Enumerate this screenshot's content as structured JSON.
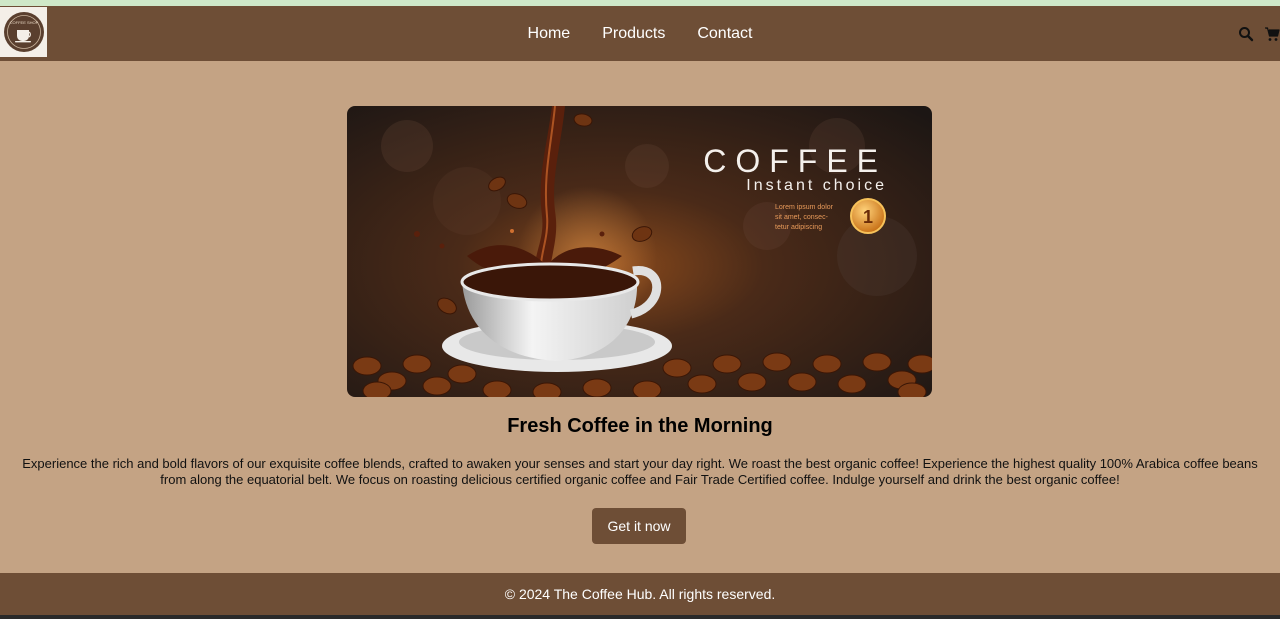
{
  "nav": {
    "logo_text": "COFFEE SHOP",
    "links": [
      {
        "label": "Home"
      },
      {
        "label": "Products"
      },
      {
        "label": "Contact"
      }
    ],
    "icons": [
      "search-icon",
      "cart-icon"
    ]
  },
  "hero": {
    "title": "COFFEE",
    "subtitle": "Instant choice",
    "blurb_line1": "Lorem ipsum dolor",
    "blurb_line2": "sit amet, consec-",
    "blurb_line3": "tetur    adipiscing",
    "badge": "1"
  },
  "main": {
    "headline": "Fresh Coffee in the Morning",
    "description": "Experience the rich and bold flavors of our exquisite coffee blends, crafted to awaken your senses and start your day right. We roast the best organic coffee! Experience the highest quality 100% Arabica coffee beans from along the equatorial belt. We focus on roasting delicious certified organic coffee and Fair Trade Certified coffee. Indulge yourself and drink the best organic coffee!",
    "cta_label": "Get it now"
  },
  "footer": {
    "copyright": "© 2024 The Coffee Hub. All rights reserved."
  },
  "colors": {
    "nav_bg": "#6e4e36",
    "page_bg": "#c4a384",
    "top_line": "#cfe8c8"
  }
}
